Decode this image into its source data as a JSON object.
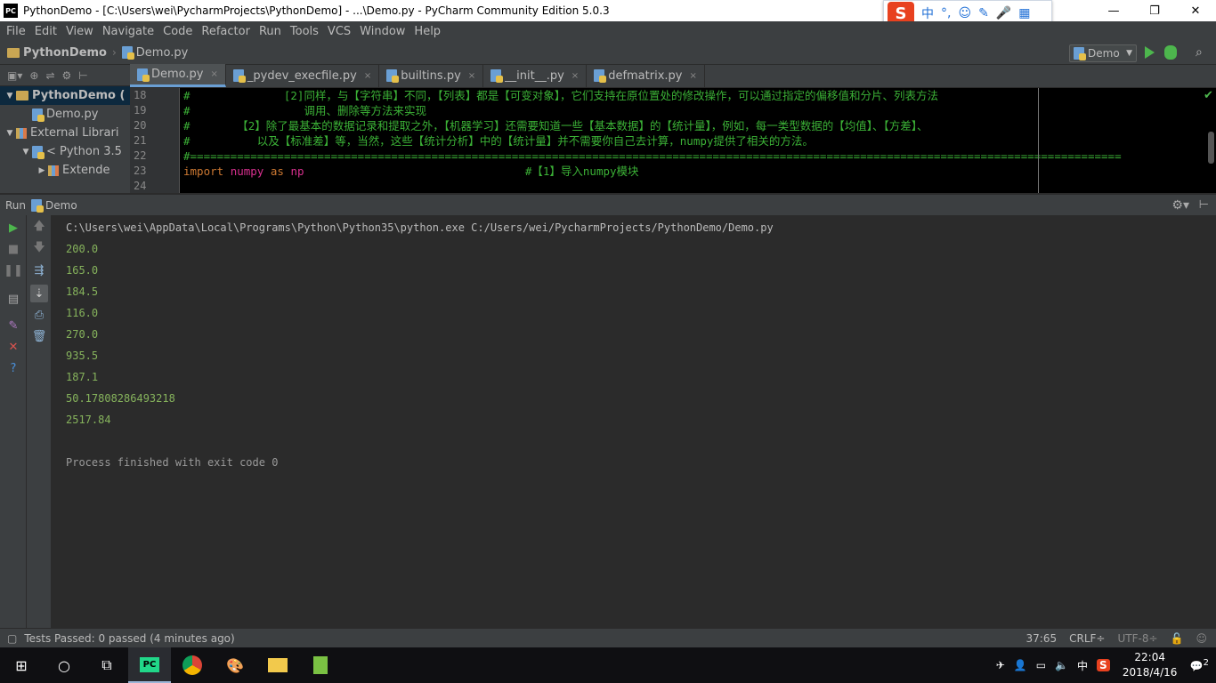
{
  "window": {
    "title": "PythonDemo - [C:\\Users\\wei\\PycharmProjects\\PythonDemo] - ...\\Demo.py - PyCharm Community Edition 5.0.3",
    "app_badge": "PC",
    "min": "—",
    "max": "❐",
    "close": "✕"
  },
  "ime": {
    "logo": "S",
    "items": [
      "中",
      "°,",
      "☺",
      "✎",
      "🎤",
      "▦"
    ]
  },
  "menu": [
    "File",
    "Edit",
    "View",
    "Navigate",
    "Code",
    "Refactor",
    "Run",
    "Tools",
    "VCS",
    "Window",
    "Help"
  ],
  "breadcrumb": {
    "project": "PythonDemo",
    "file": "Demo.py"
  },
  "run_config": {
    "name": "Demo",
    "dropdown": "▼"
  },
  "project_toolbar": [
    "⊕",
    "⇌",
    "⚙",
    "⊢"
  ],
  "project_tree": [
    {
      "label": "PythonDemo (",
      "arrow": "▼",
      "indent": 0,
      "icon": "folder",
      "selected": true
    },
    {
      "label": "Demo.py",
      "arrow": "",
      "indent": 1,
      "icon": "pyfile",
      "selected": false
    },
    {
      "label": "External Librari",
      "arrow": "▼",
      "indent": 0,
      "icon": "lib",
      "selected": false
    },
    {
      "label": "< Python 3.5",
      "arrow": "▼",
      "indent": 1,
      "icon": "python",
      "selected": false
    },
    {
      "label": "Extende",
      "arrow": "▶",
      "indent": 2,
      "icon": "lib",
      "selected": false
    }
  ],
  "tabs": [
    {
      "label": "Demo.py",
      "active": true
    },
    {
      "label": "_pydev_execfile.py",
      "active": false
    },
    {
      "label": "builtins.py",
      "active": false
    },
    {
      "label": "__init__.py",
      "active": false
    },
    {
      "label": "defmatrix.py",
      "active": false
    }
  ],
  "tab_close": "×",
  "line_numbers": [
    "18",
    "19",
    "20",
    "21",
    "22",
    "23",
    "24"
  ],
  "code": {
    "l18": "#              [2]同样，与【字符串】不同，【列表】都是【可变对象】，它们支持在原位置处的修改操作，可以通过指定的偏移值和分片、列表方法",
    "l19": "#                 调用、删除等方法来实现",
    "l20": "#       【2】除了最基本的数据记录和提取之外，【机器学习】还需要知道一些【基本数据】的【统计量】，例如，每一类型数据的【均值】、【方差】、",
    "l21": "#          以及【标准差】等，当然，这些【统计分析】中的【统计量】并不需要你自己去计算，numpy提供了相关的方法。",
    "l22": "#===========================================================================================================================================",
    "l23_kw1": "import ",
    "l23_mod": "numpy",
    "l23_kw2": " as ",
    "l23_alias": "np",
    "l23_comment": "                                 #【1】导入numpy模块",
    "l24": ""
  },
  "run_panel": {
    "label": "Run",
    "config": "Demo"
  },
  "console": {
    "command": "C:\\Users\\wei\\AppData\\Local\\Programs\\Python\\Python35\\python.exe C:/Users/wei/PycharmProjects/PythonDemo/Demo.py",
    "outputs": [
      "200.0",
      "165.0",
      "184.5",
      "116.0",
      "270.0",
      "935.5",
      "187.1",
      "50.17808286493218",
      "2517.84"
    ],
    "finished": "Process finished with exit code 0"
  },
  "status": {
    "tests": "Tests Passed: 0 passed (4 minutes ago)",
    "position": "37:65",
    "line_sep": "CRLF÷",
    "encoding": "UTF-8÷"
  },
  "taskbar": {
    "time": "22:04",
    "date": "2018/4/16",
    "ime_lang": "中",
    "notify_count": "2"
  },
  "colors": {
    "accent": "#6a9fd4",
    "run_green": "#4db64d",
    "output_green": "#86b35c"
  }
}
